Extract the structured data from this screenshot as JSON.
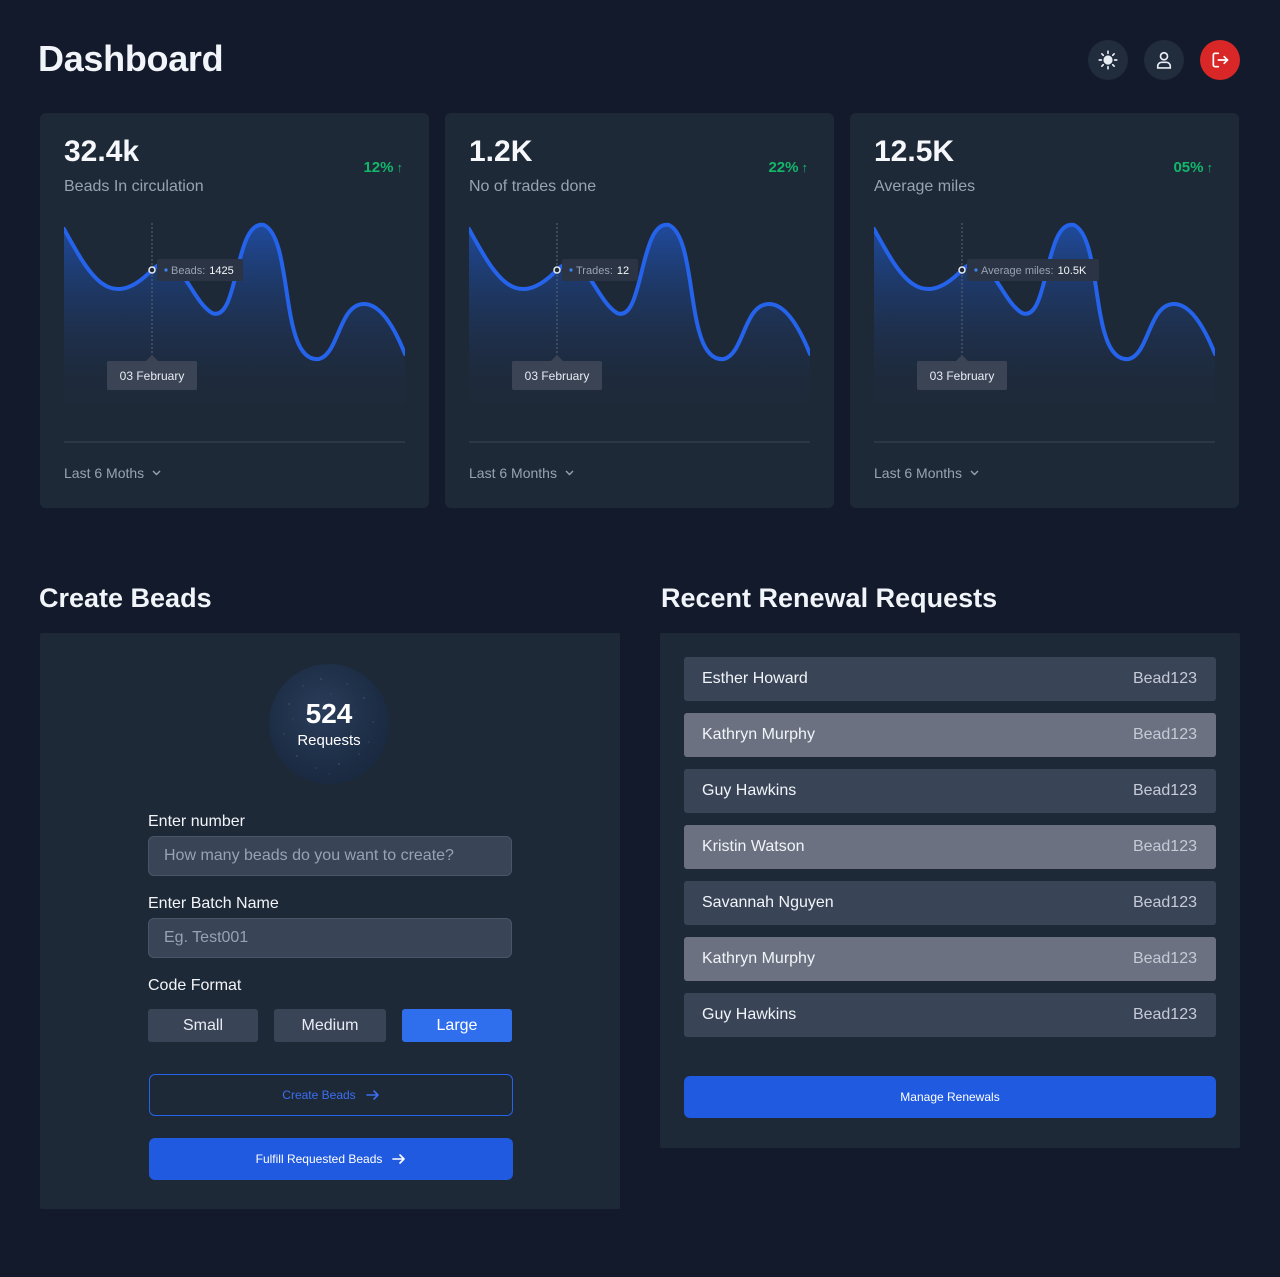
{
  "header": {
    "title": "Dashboard",
    "actions": [
      {
        "icon": "sun-icon",
        "label": "Toggle theme"
      },
      {
        "icon": "user-icon",
        "label": "Profile"
      },
      {
        "icon": "logout-icon",
        "label": "Log out"
      }
    ]
  },
  "stats": [
    {
      "value": "32.4k",
      "label": "Beads In circulation",
      "change": "12%",
      "tooltip_key": "Beads:",
      "tooltip_value": "1425",
      "date_label": "03 February",
      "period": "Last 6 Moths"
    },
    {
      "value": "1.2K",
      "label": "No of trades done",
      "change": "22%",
      "tooltip_key": "Trades:",
      "tooltip_value": "12",
      "date_label": "03 February",
      "period": "Last 6 Months"
    },
    {
      "value": "12.5K",
      "label": "Average miles",
      "change": "05%",
      "tooltip_key": "Average miles:",
      "tooltip_value": "10.5K",
      "date_label": "03 February",
      "period": "Last 6 Months"
    }
  ],
  "create_beads": {
    "title": "Create Beads",
    "request_count": "524",
    "request_label": "Requests",
    "number_label": "Enter number",
    "number_placeholder": "How many beads do you want to create?",
    "batch_label": "Enter Batch Name",
    "batch_placeholder": "Eg. Test001",
    "format_label": "Code Format",
    "formats": [
      "Small",
      "Medium",
      "Large"
    ],
    "selected_format": "Large",
    "create_button": "Create Beads",
    "fulfill_button": "Fulfill Requested Beads"
  },
  "renewals": {
    "title": "Recent Renewal Requests",
    "items": [
      {
        "name": "Esther Howard",
        "code": "Bead123"
      },
      {
        "name": "Kathryn Murphy",
        "code": "Bead123"
      },
      {
        "name": "Guy Hawkins",
        "code": "Bead123"
      },
      {
        "name": "Kristin Watson",
        "code": "Bead123"
      },
      {
        "name": "Savannah Nguyen",
        "code": "Bead123"
      },
      {
        "name": "Kathryn Murphy",
        "code": "Bead123"
      },
      {
        "name": "Guy Hawkins",
        "code": "Bead123"
      }
    ],
    "manage_button": "Manage Renewals"
  },
  "colors": {
    "background": "#121a2b",
    "card": "#1e2938",
    "accent": "#2f6fed",
    "positive": "#12b76a",
    "danger": "#d92626"
  }
}
